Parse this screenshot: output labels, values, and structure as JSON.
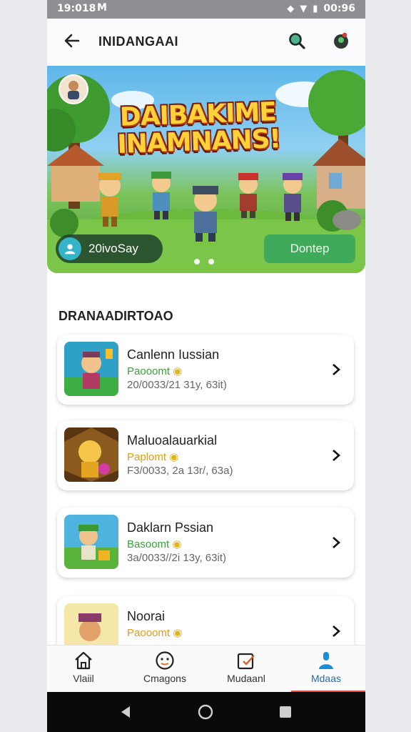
{
  "status_bar": {
    "time": "19:018",
    "mail_glyph": "M",
    "battery_text": "00:96"
  },
  "app_bar": {
    "title": "INIDANGAAI"
  },
  "banner": {
    "headline_line1": "DAIBAKIME",
    "headline_line2": "INAMNANS!",
    "user_label": "20ivoSay",
    "download_label": "Dontep",
    "carousel_pages": 2
  },
  "section": {
    "title": "DRANAADIRTOAO"
  },
  "games": [
    {
      "name": "Canlenn Iussian",
      "status": "Paooomt",
      "meta": "20/0033/21 31y, 63it)",
      "status_color": "#3aa13a"
    },
    {
      "name": "Maluoalauarkial",
      "status": "Paplomt",
      "meta": "F3/0033, 2a 13r/, 63a)",
      "status_color": "#d8a21c"
    },
    {
      "name": "Daklarn Pssian",
      "status": "Basoomt",
      "meta": "3a/0033//2i 13y, 63it)",
      "status_color": "#3aa13a"
    },
    {
      "name": "Noorai",
      "status": "Paooomt",
      "meta": "",
      "status_color": "#d8a21c"
    }
  ],
  "bottom_nav": [
    {
      "label": "Vlaiil",
      "icon": "home-icon"
    },
    {
      "label": "Cmagons",
      "icon": "compass-icon"
    },
    {
      "label": "Mudaanl",
      "icon": "edit-calendar-icon"
    },
    {
      "label": "Mdaas",
      "icon": "person-icon"
    }
  ],
  "colors": {
    "accent": "#3faa5a",
    "active_tab": "#1a8fd6",
    "nav_indicator": "#e74c3c"
  }
}
